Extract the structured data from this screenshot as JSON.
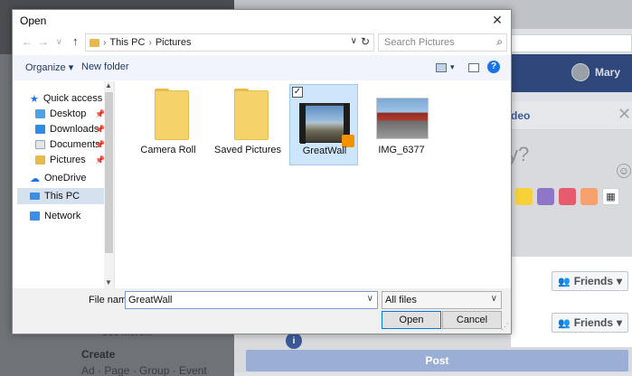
{
  "background": {
    "user_name": "Mary",
    "modal_heading_partial": "deo",
    "question_partial": "y?",
    "audience_label_1": "Friends",
    "audience_label_2": "Friends",
    "post_button": "Post",
    "create_heading": "Create",
    "create_links": "Ad · Page · Group · Event",
    "see_more": "See More..."
  },
  "dialog": {
    "title": "Open",
    "path": [
      "This PC",
      "Pictures"
    ],
    "search_placeholder": "Search Pictures",
    "toolbar": {
      "organize": "Organize ▾",
      "new_folder": "New folder"
    },
    "nav": [
      {
        "label": "Quick access",
        "pinned": false
      },
      {
        "label": "Desktop",
        "pinned": true
      },
      {
        "label": "Downloads",
        "pinned": true
      },
      {
        "label": "Documents",
        "pinned": true
      },
      {
        "label": "Pictures",
        "pinned": true
      },
      {
        "label": "OneDrive",
        "pinned": false
      },
      {
        "label": "This PC",
        "pinned": false,
        "selected": true
      },
      {
        "label": "Network",
        "pinned": false
      }
    ],
    "files": [
      {
        "name": "Camera Roll",
        "type": "folder"
      },
      {
        "name": "Saved Pictures",
        "type": "folder"
      },
      {
        "name": "GreatWall",
        "type": "video",
        "selected": true,
        "checked": true
      },
      {
        "name": "IMG_6377",
        "type": "image"
      }
    ],
    "footer": {
      "file_name_label": "File name:",
      "file_name_value": "GreatWall",
      "file_type": "All files",
      "open_button": "Open",
      "cancel_button": "Cancel"
    }
  },
  "colors": {
    "navbar": "#2f477a",
    "post_button": "#9aaed6",
    "link_blue": "#3b5998",
    "selection": "#cde6fb",
    "help": "#1a73e8"
  }
}
